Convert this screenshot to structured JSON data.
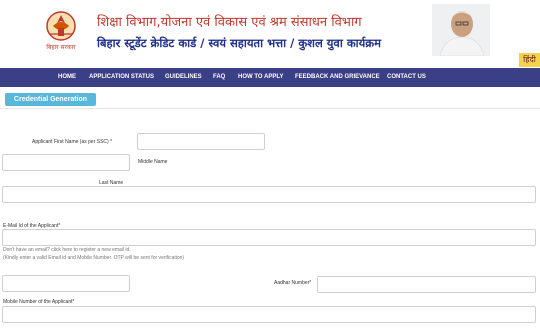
{
  "header": {
    "emblem_caption": "बिहार सरकार",
    "department": "शिक्षा विभाग,योजना एवं विकास एवं श्रम संसाधन विभाग",
    "scheme": "बिहार स्टूडेंट क्रेडिट कार्ड / स्वयं सहायता भत्ता / कुशल युवा कार्यक्रम",
    "language_button": "हिंदी"
  },
  "nav": {
    "items": [
      {
        "label": "HOME"
      },
      {
        "label": "APPLICATION STATUS"
      },
      {
        "label": "GUIDELINES"
      },
      {
        "label": "FAQ"
      },
      {
        "label": "HOW TO APPLY"
      },
      {
        "label": "FEEDBACK AND GRIEVANCE"
      },
      {
        "label": "CONTACT US"
      }
    ]
  },
  "section": {
    "title": "Credential Generation"
  },
  "form": {
    "first_name_label": "Applicant First Name (as per SSC) *",
    "middle_name_label": "Middle Name",
    "last_name_label": "Last Name",
    "email_label": "E-Mail Id of the Applicant*",
    "email_help_1": "Don't have an email? click here to register a new email id.",
    "email_help_2": "(Kindly enter a valid Email id and Mobile Number. OTP will be sent for verification)",
    "aadhar_label": "Aadhar Number*",
    "mobile_label": "Mobile Number of the Applicant*",
    "first_name_value": "",
    "middle_name_value": "",
    "last_name_value": "",
    "email_value": "",
    "aadhar_value": "",
    "mobile_value": ""
  },
  "colors": {
    "nav_bg": "#3b3f86",
    "section_pill": "#5ab7dc",
    "department_text": "#c0392b",
    "scheme_text": "#1f2f8a",
    "language_button_bg": "#f3d34a"
  }
}
